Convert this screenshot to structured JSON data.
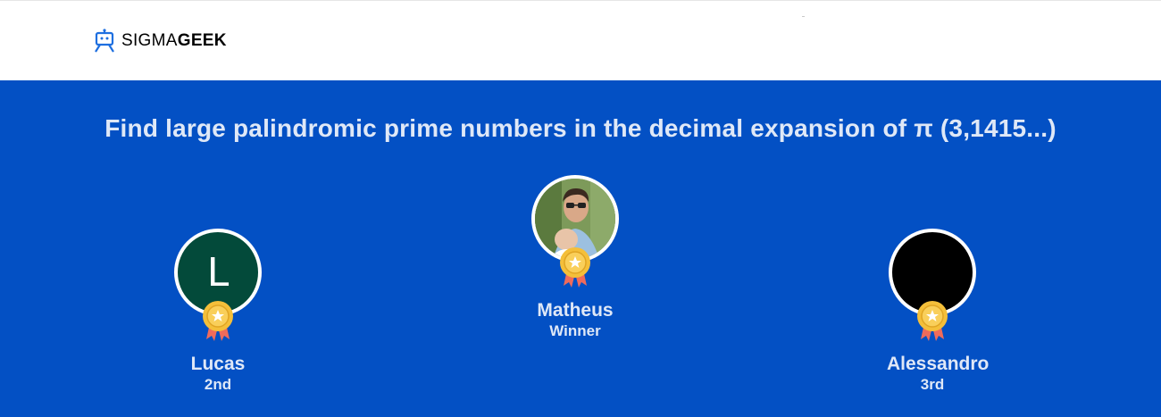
{
  "header": {
    "logo": {
      "text_light": "SIGMA",
      "text_bold": "GEEK",
      "icon": "robot-icon"
    }
  },
  "challenge": {
    "title": "Find large palindromic prime numbers in the decimal expansion of π (3,1415...)"
  },
  "podium": [
    {
      "name": "Lucas",
      "place": "2nd",
      "avatar_letter": "L",
      "avatar_color": "#034a3a",
      "medal_icon": "medal-icon"
    },
    {
      "name": "Matheus",
      "place": "Winner",
      "avatar_letter": "",
      "avatar_color": "#6c8a4a",
      "medal_icon": "medal-icon"
    },
    {
      "name": "Alessandro",
      "place": "3rd",
      "avatar_letter": "",
      "avatar_color": "#000000",
      "medal_icon": "medal-icon"
    }
  ],
  "colors": {
    "hero_bg": "#0350c4",
    "text": "#dfe8f7",
    "medal_gold": "#f4bf3a",
    "ribbon": "#ef6b5b"
  }
}
